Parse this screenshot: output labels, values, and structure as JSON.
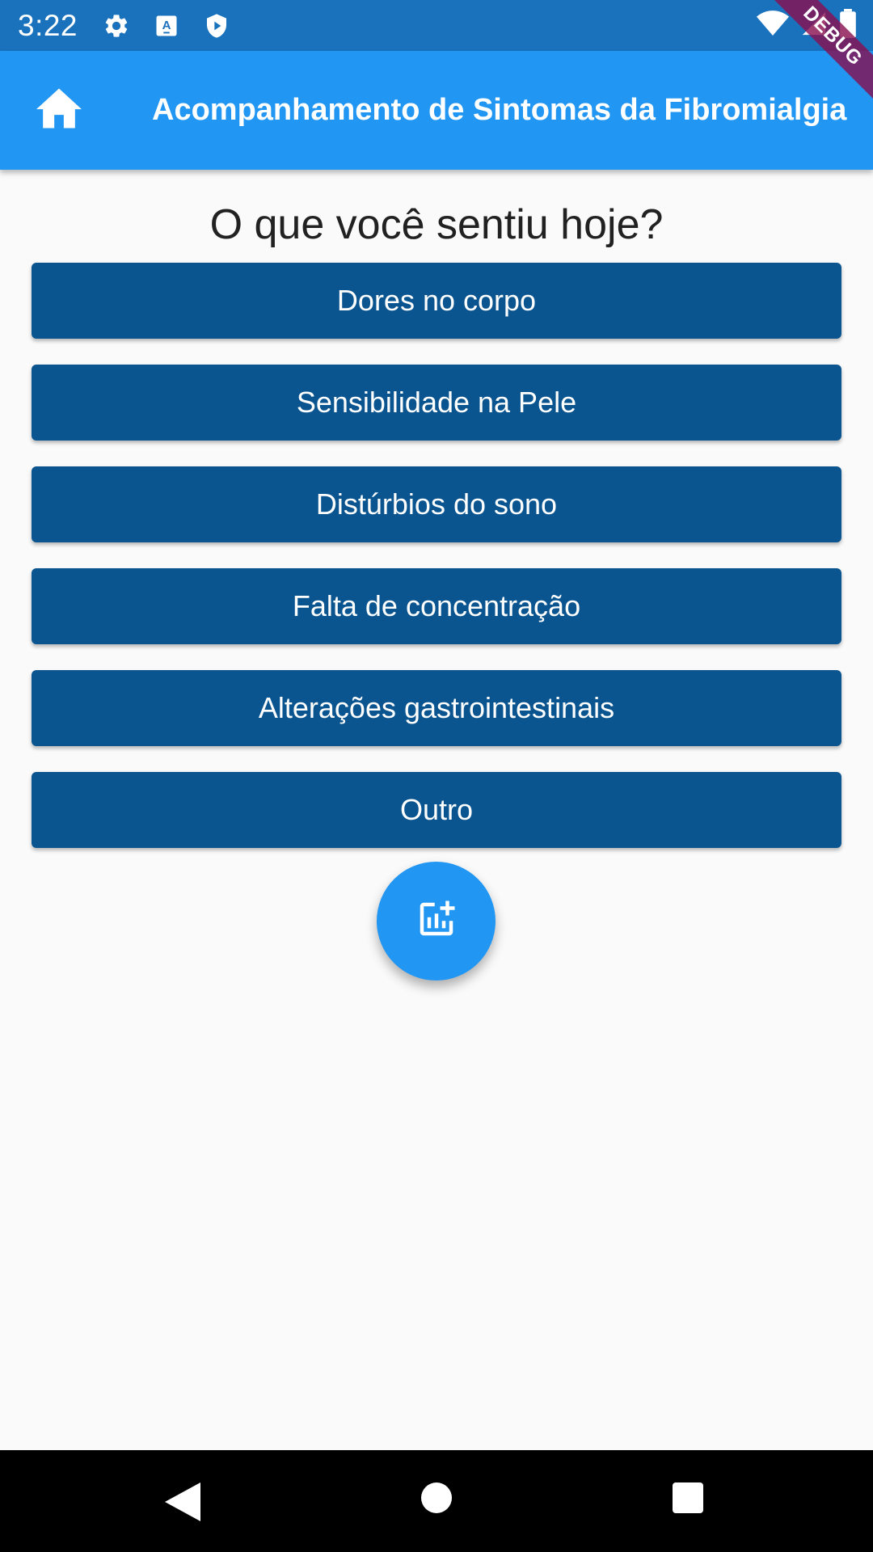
{
  "status_bar": {
    "time": "3:22",
    "left_icons": [
      "gear-icon",
      "keyboard-a-icon",
      "shield-play-icon"
    ],
    "right_icons": [
      "wifi-icon",
      "signal-icon",
      "battery-icon"
    ]
  },
  "app_bar": {
    "title": "Acompanhamento de Sintomas da Fibromialgia",
    "leading_icon": "home-icon",
    "background": "#2196f3"
  },
  "debug_banner": {
    "label": "DEBUG"
  },
  "main": {
    "question": "O que você sentiu hoje?",
    "symptoms": [
      {
        "label": "Dores no corpo"
      },
      {
        "label": "Sensibilidade na Pele"
      },
      {
        "label": "Distúrbios do sono"
      },
      {
        "label": "Falta de concentração"
      },
      {
        "label": "Alterações gastrointestinais"
      },
      {
        "label": "Outro"
      }
    ],
    "button_color": "#0a548f"
  },
  "fab": {
    "icon": "add-chart-icon",
    "color": "#2196f3"
  },
  "nav_bar": {
    "icons": [
      "back-icon",
      "home-circle-icon",
      "recents-icon"
    ]
  }
}
